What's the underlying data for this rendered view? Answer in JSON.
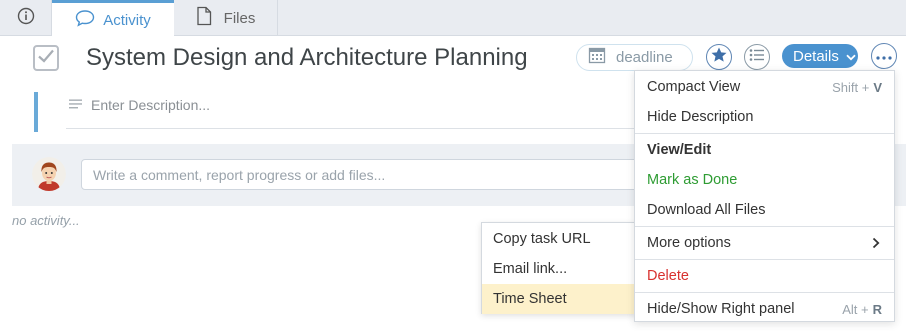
{
  "tabs": {
    "activity_label": "Activity",
    "files_label": "Files"
  },
  "task": {
    "title": "System Design and Architecture Planning",
    "deadline_label": "deadline",
    "details_label": "Details",
    "description_placeholder": "Enter Description..."
  },
  "comment": {
    "placeholder": "Write a comment, report progress or add files...",
    "no_activity": "no activity..."
  },
  "share_menu": {
    "items": [
      {
        "label": "Copy task URL"
      },
      {
        "label": "Email link..."
      },
      {
        "label": "Time Sheet"
      }
    ]
  },
  "options_menu": {
    "compact_view": "Compact View",
    "compact_view_shortcut_mod": "Shift +",
    "compact_view_shortcut_key": "V",
    "hide_description": "Hide Description",
    "view_edit": "View/Edit",
    "mark_as_done": "Mark as Done",
    "download_all_files": "Download All Files",
    "more_options": "More options",
    "delete": "Delete",
    "hide_show_right_panel": "Hide/Show Right panel",
    "right_panel_shortcut_mod": "Alt +",
    "right_panel_shortcut_key": "R"
  },
  "colors": {
    "accent": "#4a92cf",
    "mark_done": "#2e9c33",
    "delete": "#d8312f",
    "active_item": "#fdf1cb"
  },
  "icons": [
    "info-icon",
    "chat-bubble-icon",
    "file-icon",
    "checkbox-icon",
    "calendar-icon",
    "star-icon",
    "list-icon",
    "chevron-down-icon",
    "more-dots-icon",
    "description-lines-icon",
    "chevron-right-icon"
  ]
}
